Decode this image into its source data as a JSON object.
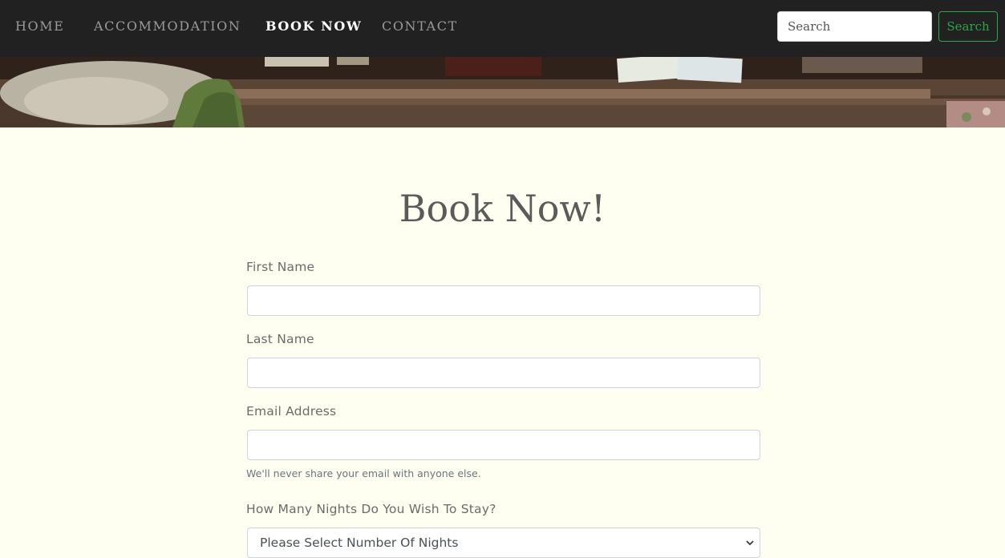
{
  "nav": {
    "links": [
      {
        "label": "HOME",
        "active": false
      },
      {
        "label": "ACCOMMODATION",
        "active": false
      },
      {
        "label": "BOOK NOW",
        "active": true
      },
      {
        "label": "CONTACT",
        "active": false
      }
    ],
    "search_placeholder": "Search",
    "search_button_label": "Search"
  },
  "hero": {
    "description_icon": "hero-banner-image"
  },
  "main": {
    "title": "Book Now!",
    "form": {
      "first_name_label": "First Name",
      "first_name_value": "",
      "last_name_label": "Last Name",
      "last_name_value": "",
      "email_label": "Email Address",
      "email_value": "",
      "email_help": "We'll never share your email with anyone else.",
      "nights_label": "How Many Nights Do You Wish To Stay?",
      "nights_selected": "Please Select Number Of Nights"
    }
  },
  "colors": {
    "navbar_bg": "#212121",
    "page_bg": "#fefff0",
    "accent_green": "#28a745",
    "title_color": "#5b5b5b"
  }
}
